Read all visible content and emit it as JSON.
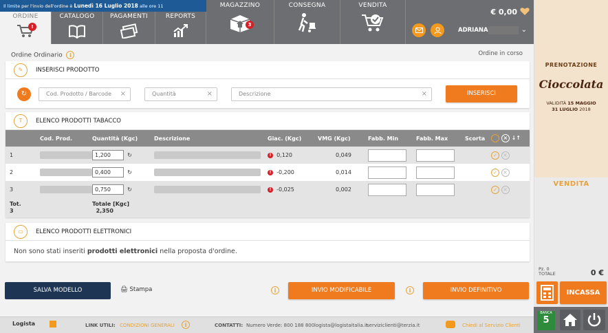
{
  "notice": {
    "prefix": "Il limite per l'invio dell'ordine è",
    "date": "Lunedì 16 Luglio 2018",
    "suffix": "alle ore 11"
  },
  "nav": {
    "tabs": [
      {
        "label": "ORDINE",
        "icon": "cart-icon",
        "badge": "!"
      },
      {
        "label": "CATALOGO",
        "icon": "book-icon"
      },
      {
        "label": "PAGAMENTI",
        "icon": "credit-card-icon"
      },
      {
        "label": "REPORTS",
        "icon": "chart-icon"
      },
      {
        "label": "MAGAZZINO",
        "icon": "box-icon",
        "badge": "3"
      },
      {
        "label": "CONSEGNA",
        "icon": "delivery-icon"
      },
      {
        "label": "VENDITA",
        "icon": "cart-check-icon"
      }
    ],
    "balance": "€ 0,00",
    "username": "ADRIANA"
  },
  "page": {
    "title": "Ordine Ordinario",
    "status": "Ordine in corso"
  },
  "insert": {
    "title": "INSERISCI PRODOTTO",
    "code_placeholder": "Cod. Prodotto / Barcode",
    "qty_placeholder": "Quantità",
    "desc_placeholder": "Descrizione",
    "button": "INSERISCI"
  },
  "tobacco": {
    "title": "ELENCO PRODOTTI TABACCO",
    "headers": {
      "code": "Cod. Prod.",
      "qty": "Quantità (Kgc)",
      "desc": "Descrizione",
      "giac": "Giac. (Kgc)",
      "vmg": "VMG (Kgc)",
      "fmin": "Fabb. Min",
      "fmax": "Fabb. Max",
      "scorta": "Scorta"
    },
    "rows": [
      {
        "n": "1",
        "qty": "1,200",
        "giac": "0,120",
        "vmg": "0,049"
      },
      {
        "n": "2",
        "qty": "0,400",
        "giac": "-0,200",
        "vmg": "0,014"
      },
      {
        "n": "3",
        "qty": "0,750",
        "giac": "-0,025",
        "vmg": "0,002"
      }
    ],
    "total_label": "Tot.",
    "total_count": "3",
    "total_kgc_label": "Totale [Kgc]",
    "total_kgc": "2,350"
  },
  "electronic": {
    "title": "ELENCO PRODOTTI ELETTRONICI",
    "message_pre": "Non sono stati inseriti",
    "message_bold": "prodotti elettronici",
    "message_post": "nella proposta d'ordine."
  },
  "actions": {
    "save_model": "SALVA MODELLO",
    "print": "Stampa",
    "send_editable": "INVIO MODIFICABILE",
    "send_final": "INVIO DEFINITIVO"
  },
  "footer": {
    "brand": "Logista",
    "links_label": "LINK UTILI:",
    "conditions": "CONDIZIONI GENERALI",
    "contacts_label": "CONTATTI:",
    "phone": "Numero Verde: 800 188 800",
    "email1": "logista@logistaitalia.it",
    "email2": "serviziclienti@terzia.it",
    "chat": "Chiedi al Servizio Clienti"
  },
  "promo": {
    "pretitle": "PRENOTAZIONE",
    "title": "Cioccolata",
    "validity": "VALIDITÀ",
    "from": "15 MAGGIO",
    "to": "31 LUGLIO",
    "year": "2018"
  },
  "sidebar": {
    "title": "VENDITA",
    "pz_label": "Pz. 0",
    "total_label": "TOTALE",
    "total": "0 €",
    "incassa": "INCASSA",
    "banca": "BANCA",
    "banca_num": "5"
  }
}
